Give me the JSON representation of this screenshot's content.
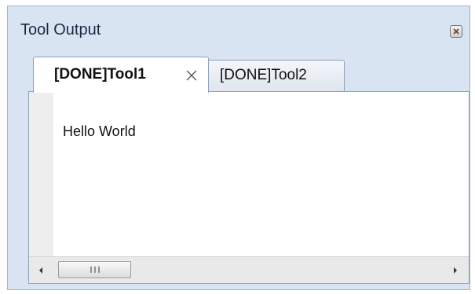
{
  "window": {
    "title": "Tool Output",
    "close_icon": "close-icon"
  },
  "tabs": [
    {
      "label": "[DONE]Tool1",
      "active": true,
      "close_icon": "close-tab-icon"
    },
    {
      "label": "[DONE]Tool2",
      "active": false
    }
  ],
  "content": {
    "text": "Hello World"
  },
  "scrollbar": {
    "left_icon": "scroll-left-arrow-icon",
    "right_icon": "scroll-right-arrow-icon",
    "thumb_icon": "scroll-thumb-grip-icon"
  },
  "colors": {
    "panel_background": "#d9e4f3",
    "panel_border": "#9fb3cc",
    "content_background": "#ffffff",
    "gutter": "#eeeeee"
  }
}
